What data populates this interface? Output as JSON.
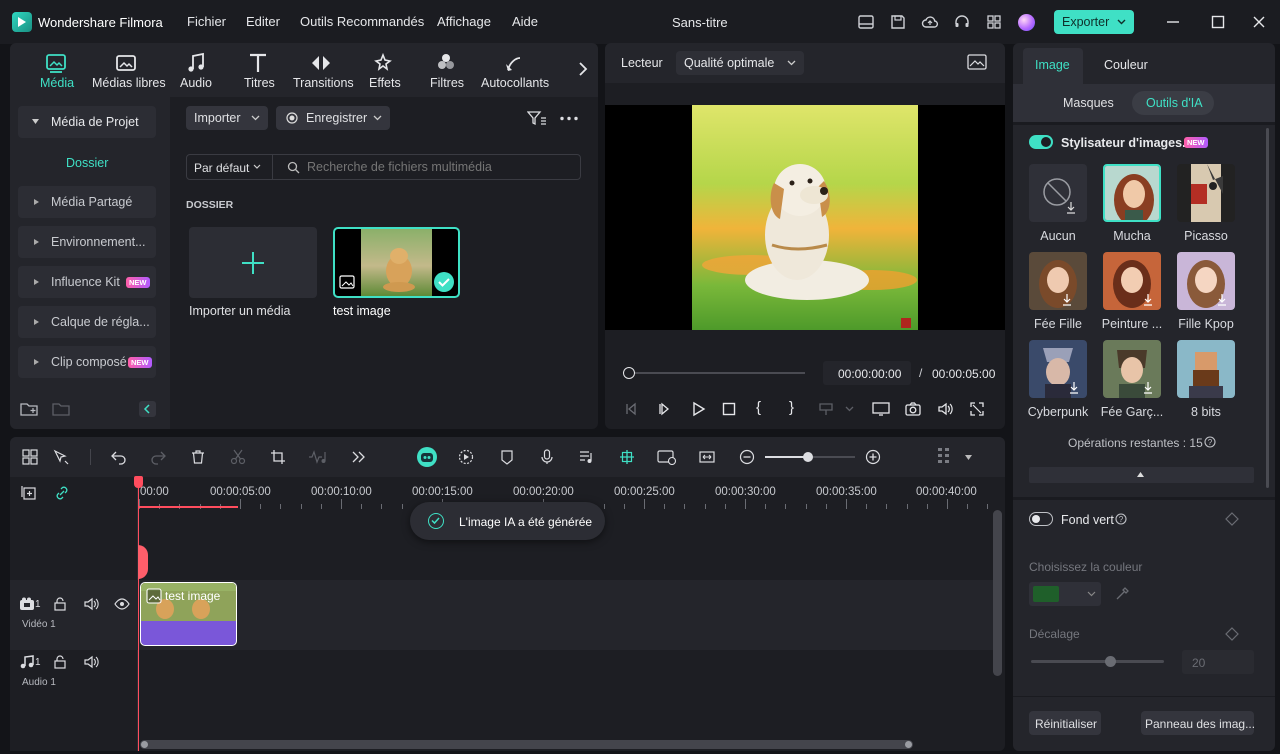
{
  "app": {
    "title": "Wondershare Filmora",
    "doc_title": "Sans-titre",
    "export_label": "Exporter"
  },
  "menu": [
    "Fichier",
    "Editer",
    "Outils Recommandés",
    "Affichage",
    "Aide"
  ],
  "media_tabs": [
    "Média",
    "Médias libres",
    "Audio",
    "Titres",
    "Transitions",
    "Effets",
    "Filtres",
    "Autocollants"
  ],
  "sidebar": {
    "project_media": "Média de Projet",
    "folder": "Dossier",
    "items": [
      {
        "label": "Média Partagé",
        "badge": ""
      },
      {
        "label": "Environnement...",
        "badge": ""
      },
      {
        "label": "Influence Kit",
        "badge": "NEW"
      },
      {
        "label": "Calque de régla...",
        "badge": ""
      },
      {
        "label": "Clip composé",
        "badge": "NEW"
      }
    ]
  },
  "media": {
    "import_label": "Importer",
    "record_label": "Enregistrer",
    "sort_label": "Par défaut",
    "search_placeholder": "Recherche de fichiers multimédia",
    "folder_heading": "DOSSIER",
    "import_tile_label": "Importer un média",
    "clip_label": "test image"
  },
  "player": {
    "label": "Lecteur",
    "quality": "Qualité optimale",
    "current_time": "00:00:00:00",
    "separator": "/",
    "total_time": "00:00:05:00"
  },
  "timeline": {
    "ruler": [
      "00:00",
      "00:00:05:00",
      "00:00:10:00",
      "00:00:15:00",
      "00:00:20:00",
      "00:00:25:00",
      "00:00:30:00",
      "00:00:35:00",
      "00:00:40:00"
    ],
    "toast": "L'image IA a été générée",
    "video_track": {
      "num": "1",
      "label": "Vidéo 1"
    },
    "audio_track": {
      "num": "1",
      "label": "Audio 1"
    },
    "clip_label": "test image"
  },
  "right_panel": {
    "tabs": [
      "Image",
      "Couleur"
    ],
    "subtabs": [
      "Masques",
      "Outils d'IA"
    ],
    "stylizer_label": "Stylisateur d'images...",
    "stylizer_badge": "NEW",
    "styles": [
      "Aucun",
      "Mucha",
      "Picasso",
      "Fée Fille",
      "Peinture ...",
      "Fille Kpop",
      "Cyberpunk",
      "Fée Garç...",
      "8 bits"
    ],
    "remaining_ops": "Opérations restantes : 15",
    "green_screen": "Fond vert",
    "choose_color": "Choisissez la couleur",
    "offset_label": "Décalage",
    "offset_value": "20",
    "offset_level": 0.6,
    "reset_label": "Réinitialiser",
    "panel_label": "Panneau des imag..."
  },
  "colors": {
    "accent": "#3fe0c5",
    "bg": "#131418",
    "panel": "#24252b",
    "export": "#3fe0c5",
    "playhead": "#ff4d5e",
    "clip_audio": "#7a57d9",
    "swatch": "#1f5f2a"
  }
}
